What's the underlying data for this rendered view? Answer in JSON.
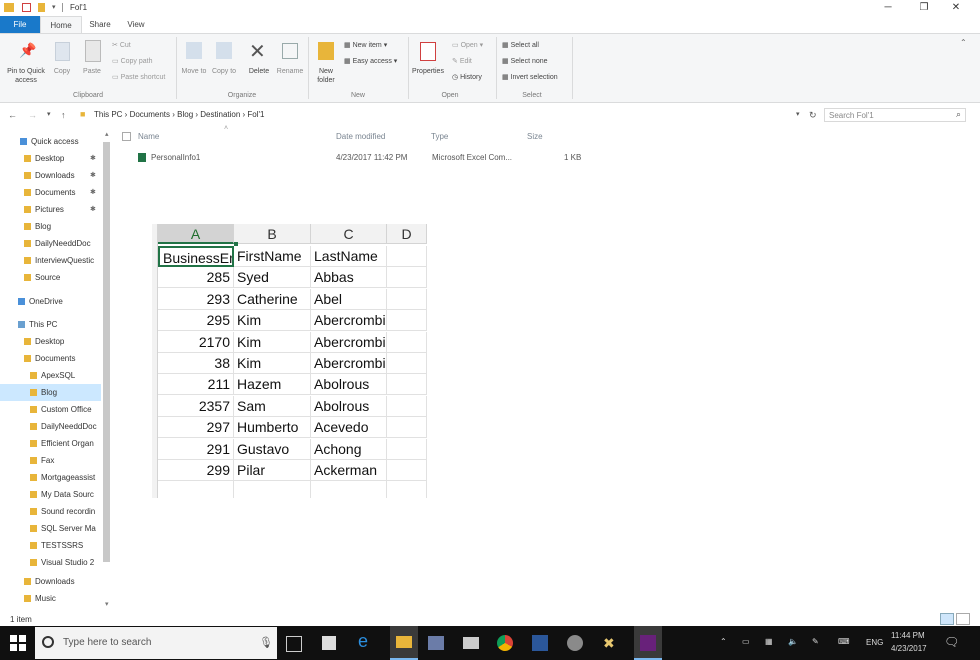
{
  "window": {
    "title": "Fol'1"
  },
  "tabs": [
    "File",
    "Home",
    "Share",
    "View"
  ],
  "ribbon": {
    "clipboard": {
      "pin": "Pin to Quick access",
      "copy": "Copy",
      "paste": "Paste",
      "cut": "Cut",
      "copy_path": "Copy path",
      "paste_shortcut": "Paste shortcut",
      "group": "Clipboard"
    },
    "organize": {
      "move_to": "Move to",
      "copy_to": "Copy to",
      "delete": "Delete",
      "rename": "Rename",
      "group": "Organize"
    },
    "new": {
      "new_folder": "New folder",
      "new_item": "New item",
      "easy_access": "Easy access",
      "group": "New"
    },
    "open": {
      "properties": "Properties",
      "open": "Open",
      "edit": "Edit",
      "history": "History",
      "group": "Open"
    },
    "select": {
      "select_all": "Select all",
      "select_none": "Select none",
      "invert": "Invert selection",
      "group": "Select"
    }
  },
  "address": {
    "crumbs": [
      "This PC",
      "Documents",
      "Blog",
      "Destination",
      "Fol'1"
    ],
    "search_placeholder": "Search Fol'1"
  },
  "sidebar": {
    "items": [
      {
        "label": "Quick access",
        "pinned": false
      },
      {
        "label": "Desktop",
        "pinned": true
      },
      {
        "label": "Downloads",
        "pinned": true
      },
      {
        "label": "Documents",
        "pinned": true
      },
      {
        "label": "Pictures",
        "pinned": true
      },
      {
        "label": "Blog",
        "pinned": false
      },
      {
        "label": "DailyNeeddDoc",
        "pinned": false
      },
      {
        "label": "InterviewQuestic",
        "pinned": false
      },
      {
        "label": "Source",
        "pinned": false
      },
      {
        "label": "OneDrive",
        "pinned": false
      },
      {
        "label": "This PC",
        "pinned": false
      },
      {
        "label": "Desktop",
        "pinned": false
      },
      {
        "label": "Documents",
        "pinned": false
      },
      {
        "label": "ApexSQL",
        "pinned": false
      },
      {
        "label": "Blog",
        "pinned": false
      },
      {
        "label": "Custom Office",
        "pinned": false
      },
      {
        "label": "DailyNeeddDoc",
        "pinned": false
      },
      {
        "label": "Efficient Organ",
        "pinned": false
      },
      {
        "label": "Fax",
        "pinned": false
      },
      {
        "label": "Mortgageassist",
        "pinned": false
      },
      {
        "label": "My Data Sourc",
        "pinned": false
      },
      {
        "label": "Sound recordin",
        "pinned": false
      },
      {
        "label": "SQL Server Ma",
        "pinned": false
      },
      {
        "label": "TESTSSRS",
        "pinned": false
      },
      {
        "label": "Visual Studio 2",
        "pinned": false
      },
      {
        "label": "Downloads",
        "pinned": false
      },
      {
        "label": "Music",
        "pinned": false
      }
    ]
  },
  "columns": {
    "name": "Name",
    "date": "Date modified",
    "type": "Type",
    "size": "Size"
  },
  "files": [
    {
      "name": "PersonalInfo1",
      "date": "4/23/2017 11:42 PM",
      "type": "Microsoft Excel Com...",
      "size": "1 KB"
    }
  ],
  "status": {
    "count": "1 item"
  },
  "excel": {
    "col_headers": [
      "A",
      "B",
      "C",
      "D"
    ],
    "header_row": [
      "BusinessEn",
      "FirstName",
      "LastName"
    ],
    "rows": [
      [
        "285",
        "Syed",
        "Abbas"
      ],
      [
        "293",
        "Catherine",
        "Abel"
      ],
      [
        "295",
        "Kim",
        "Abercrombie"
      ],
      [
        "2170",
        "Kim",
        "Abercrombie"
      ],
      [
        "38",
        "Kim",
        "Abercrombie"
      ],
      [
        "211",
        "Hazem",
        "Abolrous"
      ],
      [
        "2357",
        "Sam",
        "Abolrous"
      ],
      [
        "297",
        "Humberto",
        "Acevedo"
      ],
      [
        "291",
        "Gustavo",
        "Achong"
      ],
      [
        "299",
        "Pilar",
        "Ackerman"
      ]
    ]
  },
  "taskbar": {
    "search_placeholder": "Type here to search",
    "time": "11:44 PM",
    "date": "4/23/2017",
    "lang": "ENG"
  },
  "colors": {
    "file_tab": "#1979ca",
    "excel_green": "#217346",
    "taskbar": "#101010",
    "selection": "#cce8ff"
  }
}
